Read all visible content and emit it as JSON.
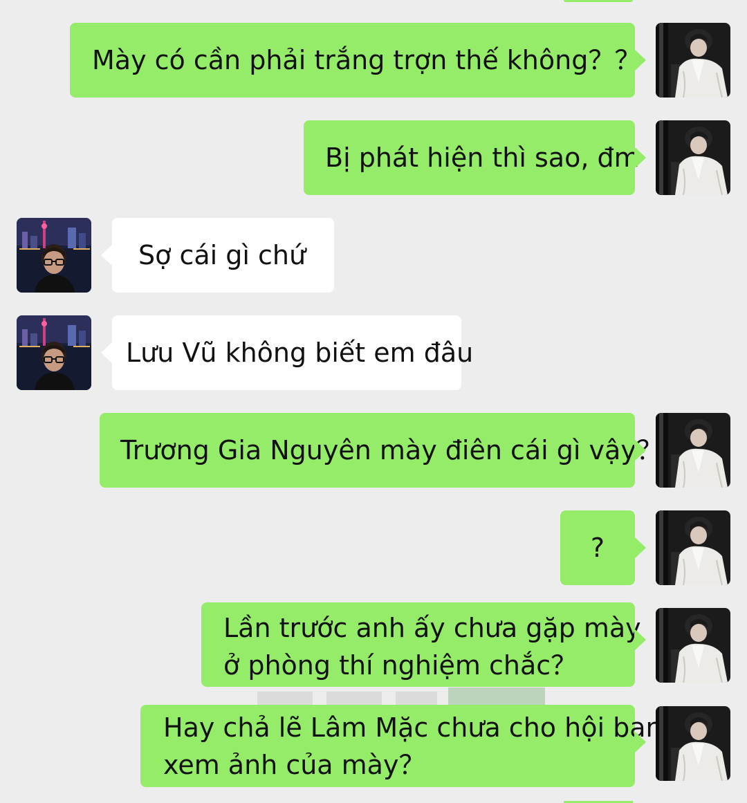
{
  "conversation": {
    "messages": [
      {
        "side": "sent",
        "text": "Mày có cần phải trắng trợn thế không？？",
        "avatar": "self-avatar"
      },
      {
        "side": "sent",
        "text": "Bị phát hiện thì sao, đm",
        "avatar": "self-avatar"
      },
      {
        "side": "received",
        "text": "Sợ cái gì chứ",
        "avatar": "contact-avatar"
      },
      {
        "side": "received",
        "text": "Lưu Vũ không biết em đâu",
        "avatar": "contact-avatar"
      },
      {
        "side": "sent",
        "text": "Trương Gia Nguyên mày điên cái gì vậy？",
        "avatar": "self-avatar"
      },
      {
        "side": "sent",
        "text": "?",
        "avatar": "self-avatar"
      },
      {
        "side": "sent",
        "lines": [
          "Lần trước anh ấy chưa gặp mày",
          "ở phòng thí nghiệm chắc？"
        ],
        "avatar": "self-avatar"
      },
      {
        "side": "sent",
        "lines": [
          "Hay chả lẽ Lâm Mặc chưa cho hội bạn",
          "xem ảnh của mày？"
        ],
        "avatar": "self-avatar"
      }
    ]
  },
  "colors": {
    "background": "#ededed",
    "sent_bubble": "#95ec69",
    "received_bubble": "#ffffff",
    "text": "#111111"
  }
}
